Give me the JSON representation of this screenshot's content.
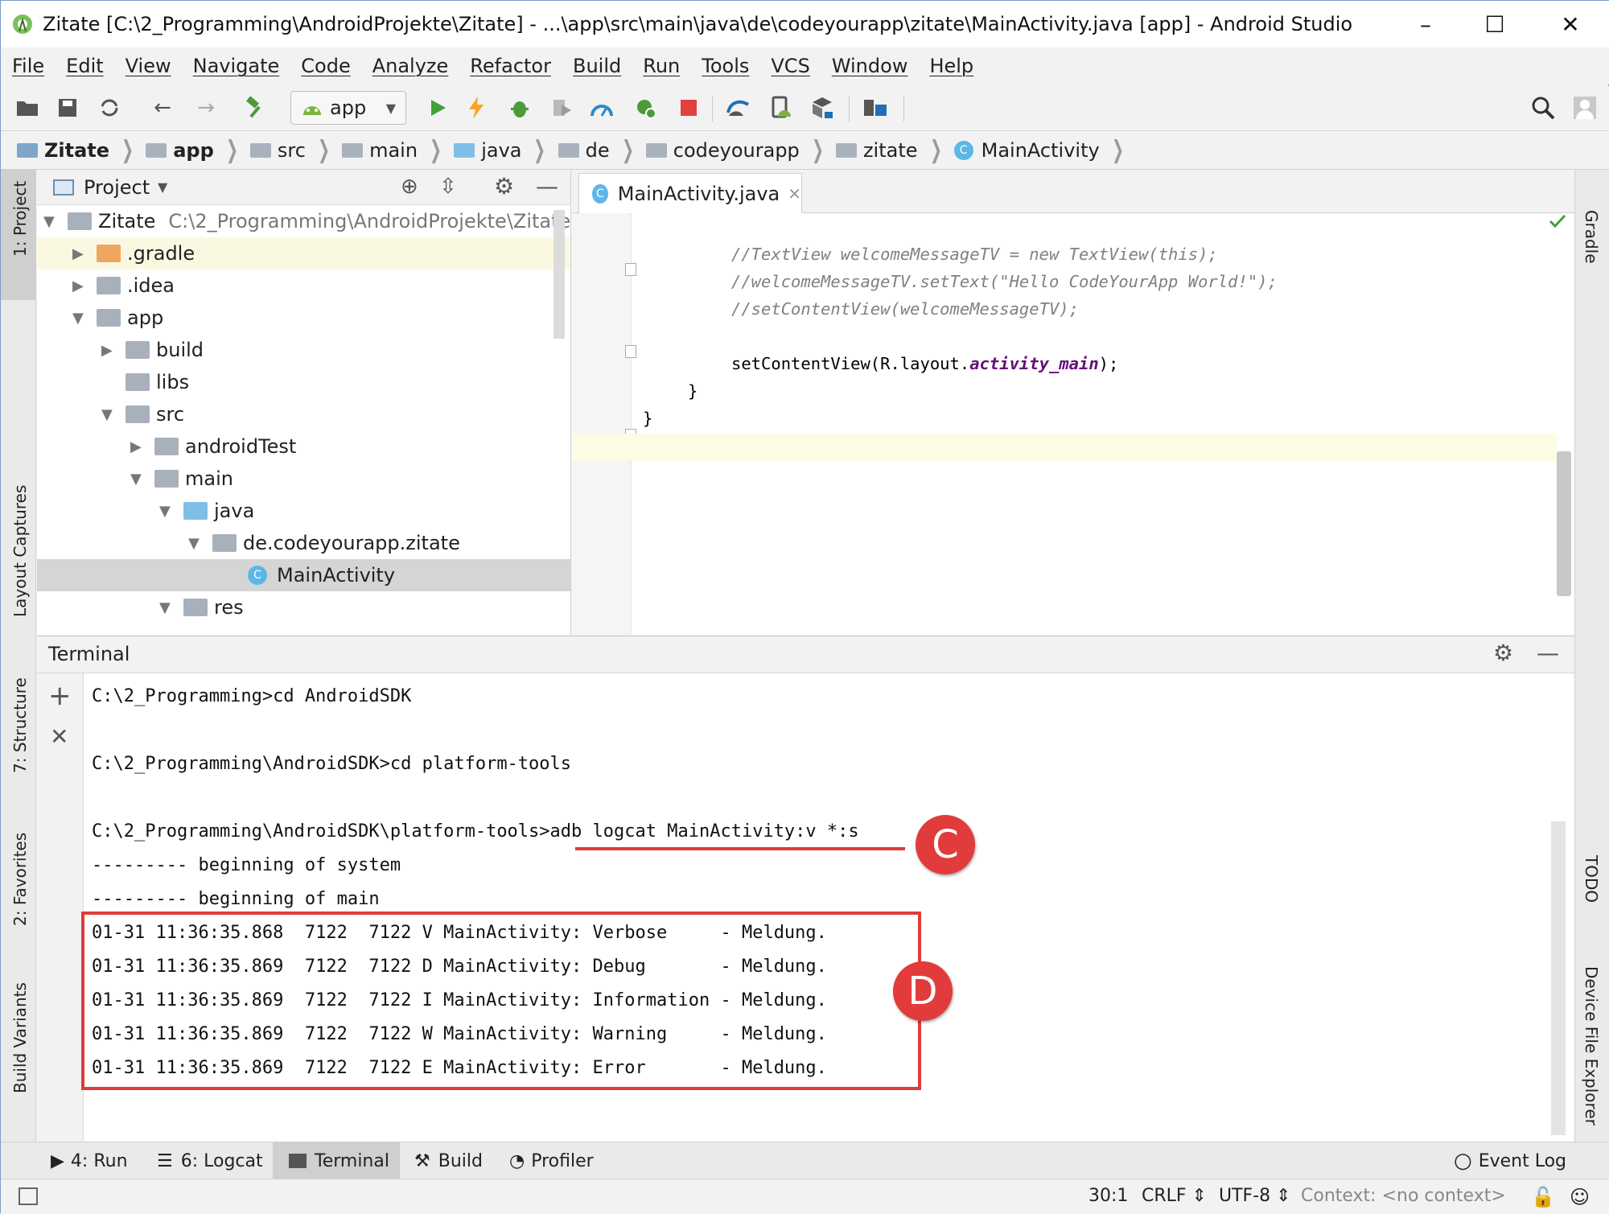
{
  "window": {
    "title": "Zitate [C:\\2_Programming\\AndroidProjekte\\Zitate] - ...\\app\\src\\main\\java\\de\\codeyourapp\\zitate\\MainActivity.java [app] - Android Studio",
    "minimize": "–",
    "maximize": "☐",
    "close": "✕"
  },
  "menu": [
    "File",
    "Edit",
    "View",
    "Navigate",
    "Code",
    "Analyze",
    "Refactor",
    "Build",
    "Run",
    "Tools",
    "VCS",
    "Window",
    "Help"
  ],
  "toolbar": {
    "run_config": "app"
  },
  "breadcrumb": [
    "Zitate",
    "app",
    "src",
    "main",
    "java",
    "de",
    "codeyourapp",
    "zitate",
    "MainActivity"
  ],
  "left_strip": {
    "project": "1: Project",
    "layout_captures": "Layout Captures",
    "structure": "7: Structure",
    "favorites": "2: Favorites",
    "build_variants": "Build Variants"
  },
  "right_strip": {
    "gradle": "Gradle",
    "todo": "TODO",
    "device_file_explorer": "Device File Explorer"
  },
  "project_panel": {
    "title": "Project",
    "tree": [
      {
        "label": "Zitate",
        "extra": "C:\\2_Programming\\AndroidProjekte\\Zitate"
      },
      {
        "label": ".gradle",
        "extra": ""
      },
      {
        "label": ".idea",
        "extra": ""
      },
      {
        "label": "app",
        "extra": ""
      },
      {
        "label": "build",
        "extra": ""
      },
      {
        "label": "libs",
        "extra": ""
      },
      {
        "label": "src",
        "extra": ""
      },
      {
        "label": "androidTest",
        "extra": ""
      },
      {
        "label": "main",
        "extra": ""
      },
      {
        "label": "java",
        "extra": ""
      },
      {
        "label": "de.codeyourapp.zitate",
        "extra": ""
      },
      {
        "label": "MainActivity",
        "extra": ""
      },
      {
        "label": "res",
        "extra": ""
      }
    ]
  },
  "editor": {
    "tab": "MainActivity.java",
    "lines": {
      "l1": "//TextView welcomeMessageTV = new TextView(this);",
      "l2": "//welcomeMessageTV.setText(\"Hello CodeYourApp World!\");",
      "l3": "//setContentView(welcomeMessageTV);",
      "l4_pre": "setContentView(R.layout.",
      "l4_field": "activity_main",
      "l4_post": ");",
      "l5": "}",
      "l6": "}"
    }
  },
  "terminal": {
    "title": "Terminal",
    "lines": [
      "C:\\2_Programming>cd AndroidSDK",
      "C:\\2_Programming\\AndroidSDK>cd platform-tools",
      "C:\\2_Programming\\AndroidSDK\\platform-tools>adb logcat MainActivity:v *:s",
      "--------- beginning of system",
      "--------- beginning of main",
      "01-31 11:36:35.868  7122  7122 V MainActivity: Verbose     - Meldung.",
      "01-31 11:36:35.869  7122  7122 D MainActivity: Debug       - Meldung.",
      "01-31 11:36:35.869  7122  7122 I MainActivity: Information - Meldung.",
      "01-31 11:36:35.869  7122  7122 W MainActivity: Warning     - Meldung.",
      "01-31 11:36:35.869  7122  7122 E MainActivity: Error       - Meldung."
    ]
  },
  "annotations": {
    "c": "C",
    "d": "D"
  },
  "bottom_tabs": {
    "run": "4: Run",
    "logcat": "6: Logcat",
    "terminal": "Terminal",
    "build": "Build",
    "profiler": "Profiler",
    "event_log": "Event Log"
  },
  "status": {
    "position": "30:1",
    "line_sep": "CRLF ⇕",
    "encoding": "UTF-8 ⇕",
    "context": "Context: <no context>"
  },
  "colors": {
    "accent_red": "#e23b3b",
    "selection": "#d5d5d5",
    "folder": "#a8b1bb"
  }
}
